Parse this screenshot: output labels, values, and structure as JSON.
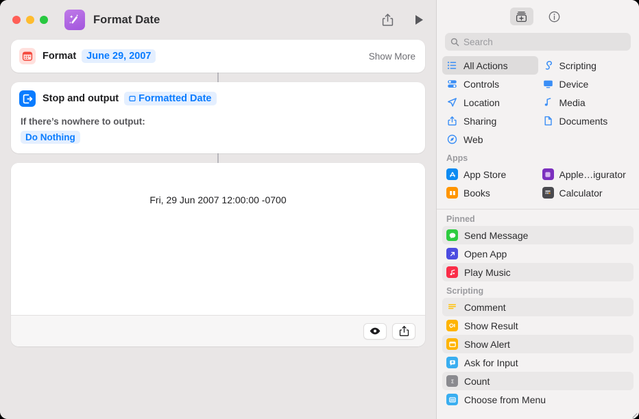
{
  "window": {
    "title": "Format Date",
    "app_icon": "magic-wand-icon",
    "traffic_lights": [
      "close",
      "minimize",
      "zoom"
    ],
    "toolbar": {
      "share_label": "share-icon",
      "run_label": "play-icon"
    }
  },
  "editor": {
    "actions": [
      {
        "icon": "calendar-icon",
        "label": "Format",
        "token": "June 29, 2007",
        "trailing": "Show More"
      },
      {
        "icon": "stop-output-icon",
        "label": "Stop and output",
        "token": "Formatted Date",
        "sub_label": "If there’s nowhere to output:",
        "chip": "Do Nothing"
      }
    ],
    "preview": {
      "text": "Fri, 29 Jun 2007 12:00:00 -0700",
      "buttons": [
        "eye-icon",
        "share-icon"
      ]
    }
  },
  "sidebar": {
    "tabs": [
      {
        "name": "actions-library",
        "selected": true
      },
      {
        "name": "info",
        "selected": false
      }
    ],
    "search": {
      "placeholder": "Search",
      "value": ""
    },
    "categories": [
      {
        "label": "All Actions",
        "icon": "list-icon",
        "color": "#3a8ef6",
        "selected": true
      },
      {
        "label": "Scripting",
        "icon": "scripting-icon",
        "color": "#3a8ef6",
        "selected": false
      },
      {
        "label": "Controls",
        "icon": "controls-icon",
        "color": "#3a8ef6",
        "selected": false
      },
      {
        "label": "Device",
        "icon": "display-icon",
        "color": "#3a8ef6",
        "selected": false
      },
      {
        "label": "Location",
        "icon": "location-icon",
        "color": "#3a8ef6",
        "selected": false
      },
      {
        "label": "Media",
        "icon": "music-note-icon",
        "color": "#3a8ef6",
        "selected": false
      },
      {
        "label": "Sharing",
        "icon": "share-icon",
        "color": "#3a8ef6",
        "selected": false
      },
      {
        "label": "Documents",
        "icon": "document-icon",
        "color": "#3a8ef6",
        "selected": false
      },
      {
        "label": "Web",
        "icon": "safari-icon",
        "color": "#3a8ef6",
        "selected": false
      }
    ],
    "sections": [
      {
        "title": "Apps",
        "items": [
          {
            "label": "App Store",
            "icon": "app-store-icon",
            "color": "#0d8bf2"
          },
          {
            "label": "Apple…igurator",
            "icon": "apple-configurator-icon",
            "color": "#7b2fbe"
          },
          {
            "label": "Books",
            "icon": "books-icon",
            "color": "#ff9500"
          },
          {
            "label": "Calculator",
            "icon": "calculator-icon",
            "color": "#4a4a4f"
          }
        ]
      },
      {
        "title": "Pinned",
        "items": [
          {
            "label": "Send Message",
            "icon": "messages-icon",
            "color": "#2ecc40"
          },
          {
            "label": "Open App",
            "icon": "open-app-icon",
            "color": "#4c4ce0"
          },
          {
            "label": "Play Music",
            "icon": "music-icon",
            "color": "#fa2d48"
          }
        ]
      },
      {
        "title": "Scripting",
        "items": [
          {
            "label": "Comment",
            "icon": "comment-icon",
            "color": "#ffc107"
          },
          {
            "label": "Show Result",
            "icon": "show-result-icon",
            "color": "#ffb400"
          },
          {
            "label": "Show Alert",
            "icon": "show-alert-icon",
            "color": "#ffb400"
          },
          {
            "label": "Ask for Input",
            "icon": "ask-input-icon",
            "color": "#3aaef0"
          },
          {
            "label": "Count",
            "icon": "count-icon",
            "color": "#8a8a8f"
          },
          {
            "label": "Choose from Menu",
            "icon": "choose-menu-icon",
            "color": "#3aaef0"
          }
        ]
      }
    ]
  },
  "colors": {
    "accent": "#0a7cff",
    "canvas": "#e9e6e6",
    "sidebar": "#f4f2f2"
  }
}
